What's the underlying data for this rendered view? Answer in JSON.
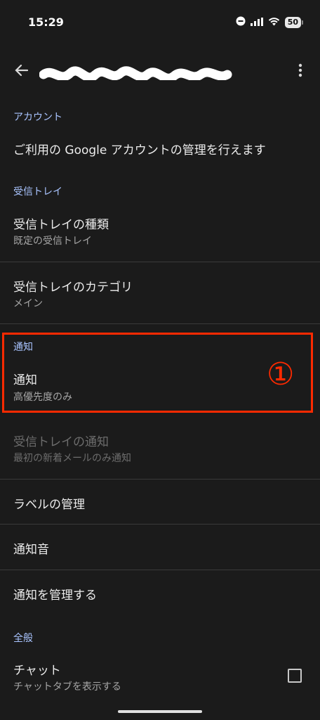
{
  "status_bar": {
    "time": "15:29",
    "battery": "50",
    "icons": [
      "do-not-disturb-icon",
      "signal-icon",
      "wifi-icon",
      "battery-icon"
    ]
  },
  "app_bar": {
    "back_icon": "arrow-left-icon",
    "more_icon": "more-vert-icon"
  },
  "sections": {
    "account": {
      "header": "アカウント",
      "manage": "ご利用の Google アカウントの管理を行えます"
    },
    "inbox": {
      "header": "受信トレイ",
      "type_title": "受信トレイの種類",
      "type_value": "既定の受信トレイ",
      "category_title": "受信トレイのカテゴリ",
      "category_value": "メイン"
    },
    "notifications": {
      "header": "通知",
      "notif_title": "通知",
      "notif_value": "高優先度のみ",
      "inbox_notif_title": "受信トレイの通知",
      "inbox_notif_value": "最初の新着メールのみ通知",
      "labels_title": "ラベルの管理",
      "sound_title": "通知音",
      "manage_title": "通知を管理する"
    },
    "general": {
      "header": "全般",
      "chat_title": "チャット",
      "chat_value": "チャットタブを表示する",
      "chat_checked": false
    }
  },
  "annotation": {
    "marker": "①",
    "color": "#ff2a00"
  }
}
